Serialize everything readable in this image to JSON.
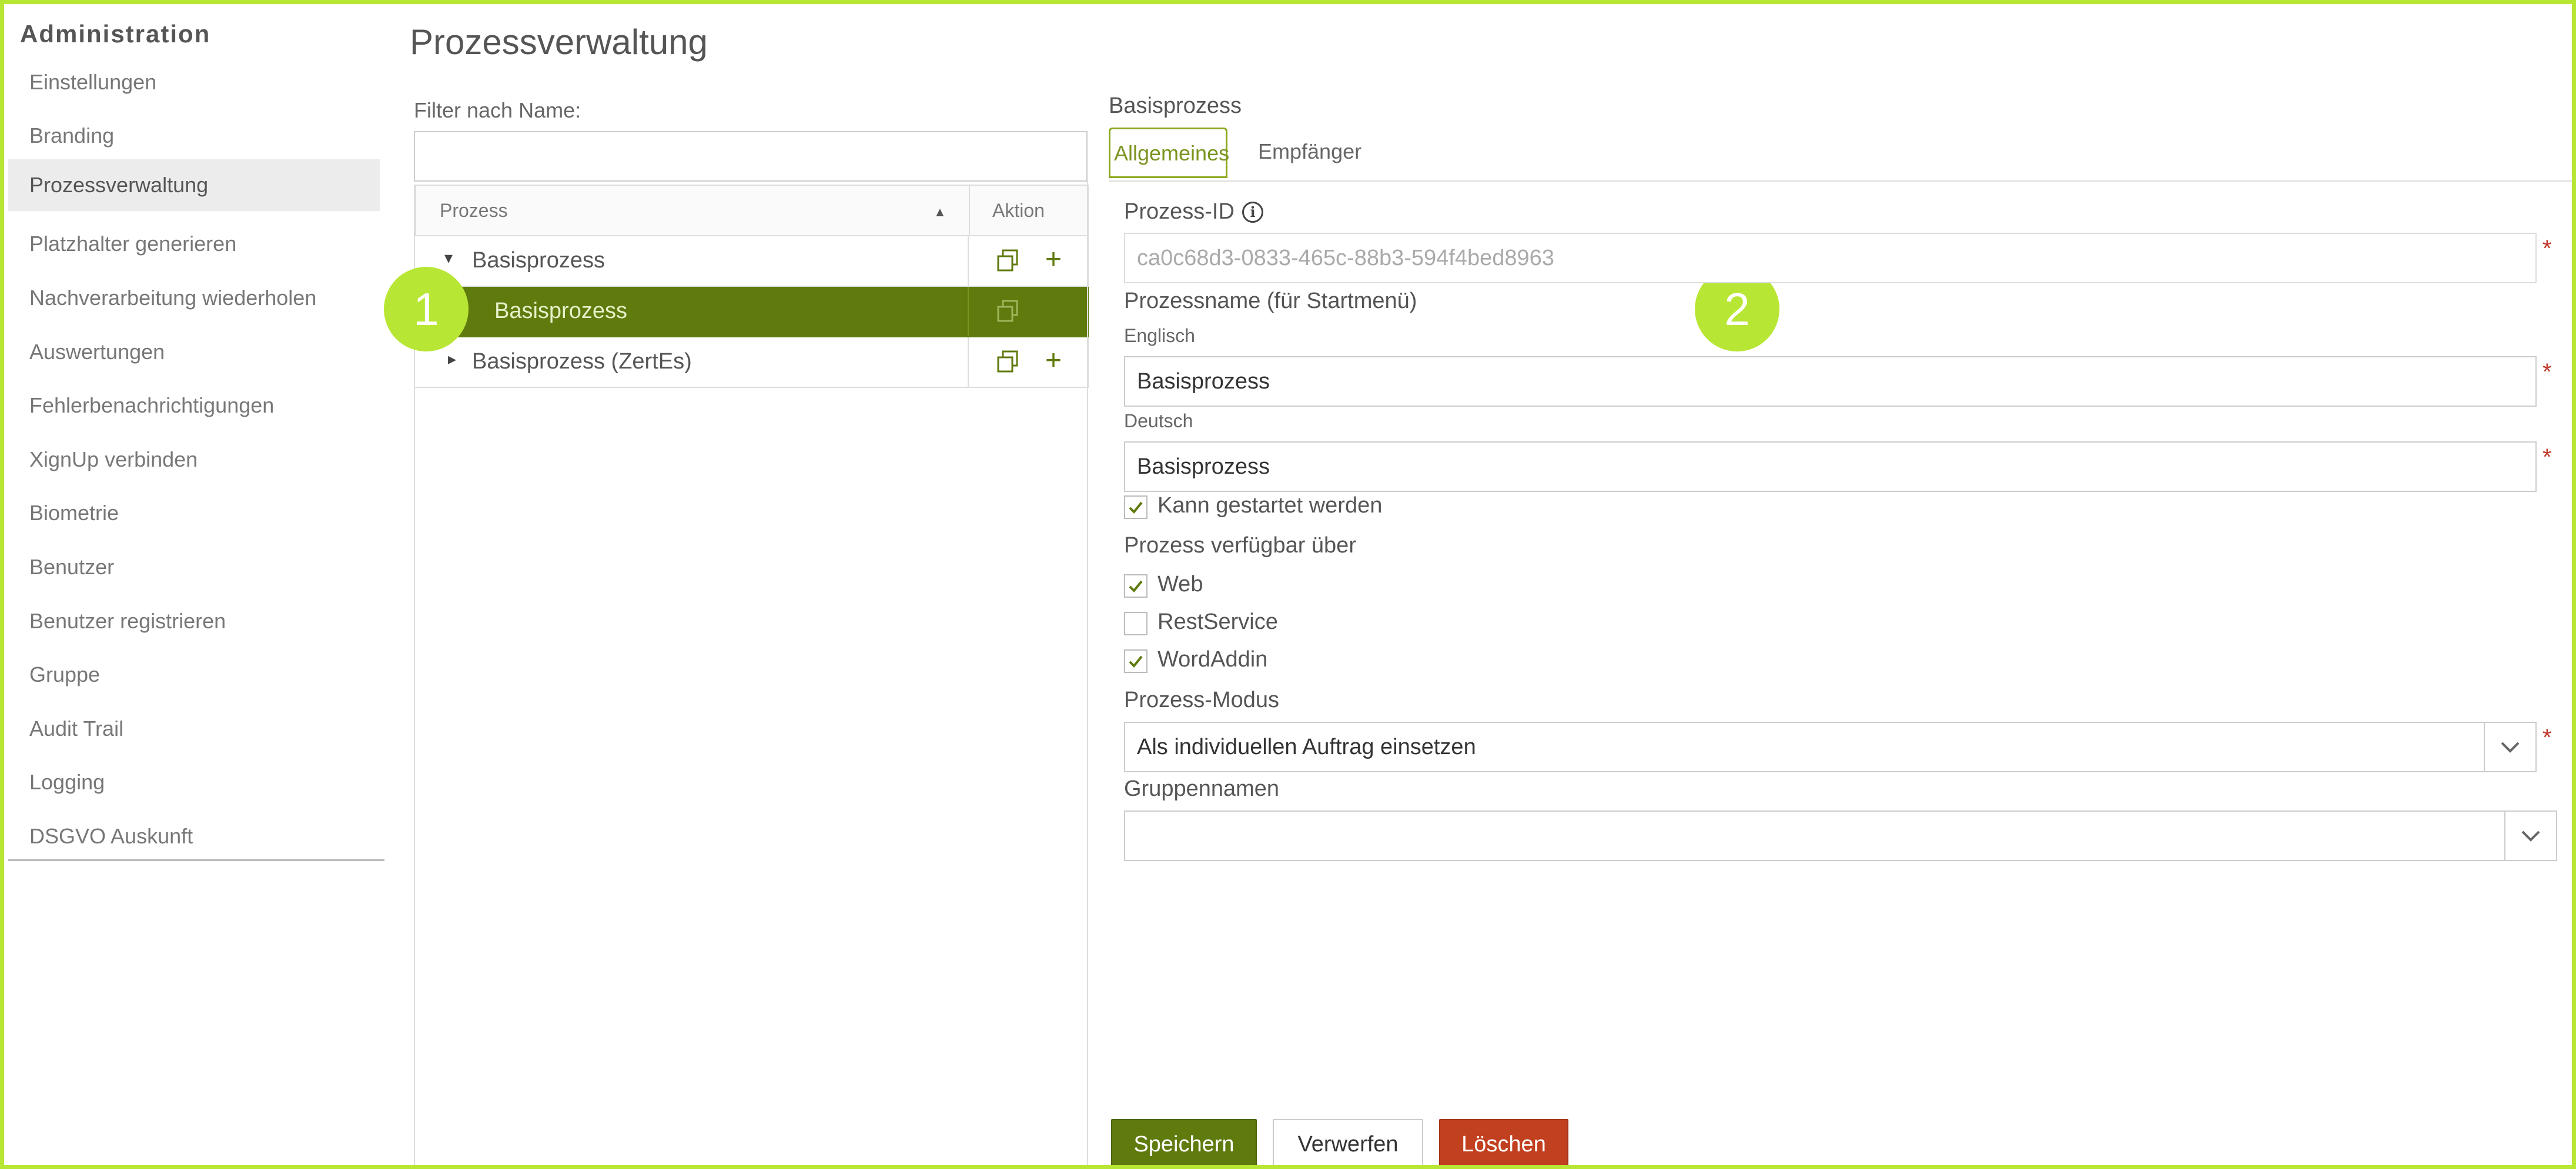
{
  "sidebar": {
    "title": "Administration",
    "items": [
      {
        "label": "Einstellungen"
      },
      {
        "label": "Branding"
      },
      {
        "label": "Prozessverwaltung",
        "active": true
      },
      {
        "label": "Platzhalter generieren"
      },
      {
        "label": "Nachverarbeitung wiederholen"
      },
      {
        "label": "Auswertungen"
      },
      {
        "label": "Fehlerbenachrichtigungen"
      },
      {
        "label": "XignUp verbinden"
      },
      {
        "label": "Biometrie"
      },
      {
        "label": "Benutzer"
      },
      {
        "label": "Benutzer registrieren"
      },
      {
        "label": "Gruppe"
      },
      {
        "label": "Audit Trail"
      },
      {
        "label": "Logging"
      },
      {
        "label": "DSGVO Auskunft"
      }
    ]
  },
  "page": {
    "title": "Prozessverwaltung"
  },
  "filter": {
    "label": "Filter nach Name:",
    "value": ""
  },
  "tree": {
    "col_process": "Prozess",
    "col_action": "Aktion",
    "rows": [
      {
        "label": "Basisprozess",
        "level": 0,
        "expanded": true
      },
      {
        "label": "Basisprozess",
        "level": 1,
        "selected": true
      },
      {
        "label": "Basisprozess (ZertEs)",
        "level": 0,
        "expanded": false
      }
    ]
  },
  "callouts": [
    "1",
    "2"
  ],
  "form": {
    "header": "Basisprozess",
    "tabs": [
      {
        "label": "Allgemeines",
        "active": true
      },
      {
        "label": "Empfänger",
        "active": false
      }
    ],
    "process_id_label": "Prozess-ID",
    "process_id_value": "ca0c68d3-0833-465c-88b3-594f4bed8963",
    "process_name_label": "Prozessname (für Startmenü)",
    "lang_en_label": "Englisch",
    "lang_en_value": "Basisprozess",
    "lang_de_label": "Deutsch",
    "lang_de_value": "Basisprozess",
    "can_start_label": "Kann gestartet werden",
    "can_start_checked": true,
    "available_label": "Prozess verfügbar über",
    "channels": [
      {
        "label": "Web",
        "checked": true
      },
      {
        "label": "RestService",
        "checked": false
      },
      {
        "label": "WordAddin",
        "checked": true
      }
    ],
    "mode_label": "Prozess-Modus",
    "mode_value": "Als individuellen Auftrag einsetzen",
    "group_label": "Gruppennamen",
    "group_value": "",
    "required_mark": "*"
  },
  "buttons": {
    "save": "Speichern",
    "discard": "Verwerfen",
    "delete": "Löschen"
  },
  "colors": {
    "accent": "#5f7a0d",
    "highlight": "#b8e634",
    "danger": "#c1401f"
  }
}
